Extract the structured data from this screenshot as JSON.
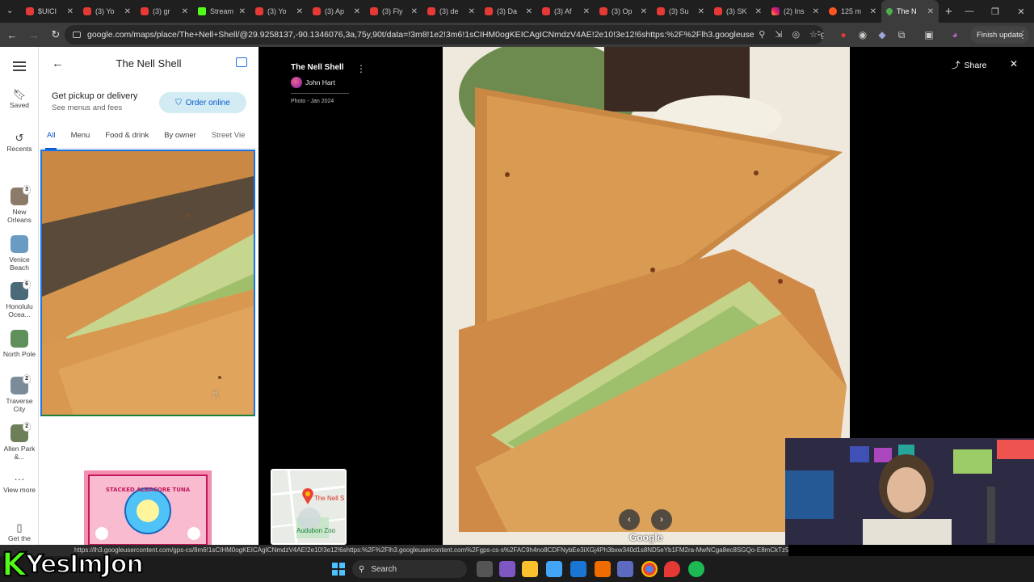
{
  "browser": {
    "tabs": [
      {
        "label": "$UICI",
        "favicon": "youtube-icon"
      },
      {
        "label": "(3) Yo",
        "favicon": "youtube-icon"
      },
      {
        "label": "(3) gr",
        "favicon": "youtube-icon"
      },
      {
        "label": "Stream",
        "favicon": "kick-icon"
      },
      {
        "label": "(3) Yo",
        "favicon": "youtube-icon"
      },
      {
        "label": "(3) Ap",
        "favicon": "youtube-icon"
      },
      {
        "label": "(3) Fly",
        "favicon": "youtube-icon"
      },
      {
        "label": "(3) de",
        "favicon": "youtube-icon"
      },
      {
        "label": "(3) Da",
        "favicon": "youtube-icon"
      },
      {
        "label": "(3) Af",
        "favicon": "youtube-icon"
      },
      {
        "label": "(3) Op",
        "favicon": "youtube-icon"
      },
      {
        "label": "(3) Su",
        "favicon": "youtube-icon"
      },
      {
        "label": "(3) SK",
        "favicon": "youtube-icon"
      },
      {
        "label": "(2) Ins",
        "favicon": "instagram-icon"
      },
      {
        "label": "125 m",
        "favicon": "reddit-icon"
      },
      {
        "label": "The N",
        "favicon": "maps-icon",
        "active": true
      }
    ],
    "url": "google.com/maps/place/The+Nell+Shell/@29.9258137,-90.1346076,3a,75y,90t/data=!3m8!1e2!3m6!1sCIHM0ogKEICAgICNmdzV4AE!2e10!3e12!6shttps:%2F%2Flh3.googleusercontent.com%2Fgps-cs...",
    "finish_update": "Finish update",
    "status_url": "https://lh3.googleusercontent.com/gps-cs/8m6!1sCIHM0ogKEICAgICNmdzV4AE!2e10!3e12!6shttps:%2F%2Flh3.googleusercontent.com%2Fgps-cs-s%2FAC9h4no8CDFNybEe3iXGj4Ph3bxw340d1s8ND5eYb1FM2ra-MwNCga8ec8SGQo-E8mCkTz5_yrk8XB8iP6CoN4rmFP9JYdSqw9Gyh70OGz"
  },
  "rail": {
    "saved": "Saved",
    "recents": "Recents",
    "places": [
      {
        "label": "New Orleans",
        "badge": "3",
        "color": "#8d7b6a"
      },
      {
        "label": "Venice Beach",
        "badge": "",
        "color": "#6a9bc3"
      },
      {
        "label": "Honolulu Ocea...",
        "badge": "6",
        "color": "#4a6a7a"
      },
      {
        "label": "North Pole",
        "badge": "",
        "color": "#5f8f5a"
      },
      {
        "label": "Traverse City",
        "badge": "2",
        "color": "#7a8c99"
      },
      {
        "label": "Allen Park &...",
        "badge": "2",
        "color": "#6c7f59"
      }
    ],
    "view_more": "View more",
    "get_app": "Get the"
  },
  "panel": {
    "title": "The Nell Shell",
    "pickup_title": "Get pickup or delivery",
    "pickup_sub": "See menus and fees",
    "order_online": "Order online",
    "tabs": [
      "All",
      "Menu",
      "Food & drink",
      "By owner",
      "Street Vie"
    ],
    "tab2_text": "STACKED ALBACORE TUNA"
  },
  "viewer": {
    "place": "The Nell Shell",
    "author": "John Hart",
    "date": "Photo - Jan 2024",
    "share": "Share",
    "google": "Google",
    "map_label": "The Nell S",
    "map_label2": "Audubon Zoo"
  },
  "taskbar": {
    "search": "Search"
  },
  "watermark": {
    "text": "YesImJon",
    "k": "K"
  },
  "colors": {
    "accent": "#1a73e8",
    "kick": "#53fc18",
    "toast": "#d79a4e"
  }
}
